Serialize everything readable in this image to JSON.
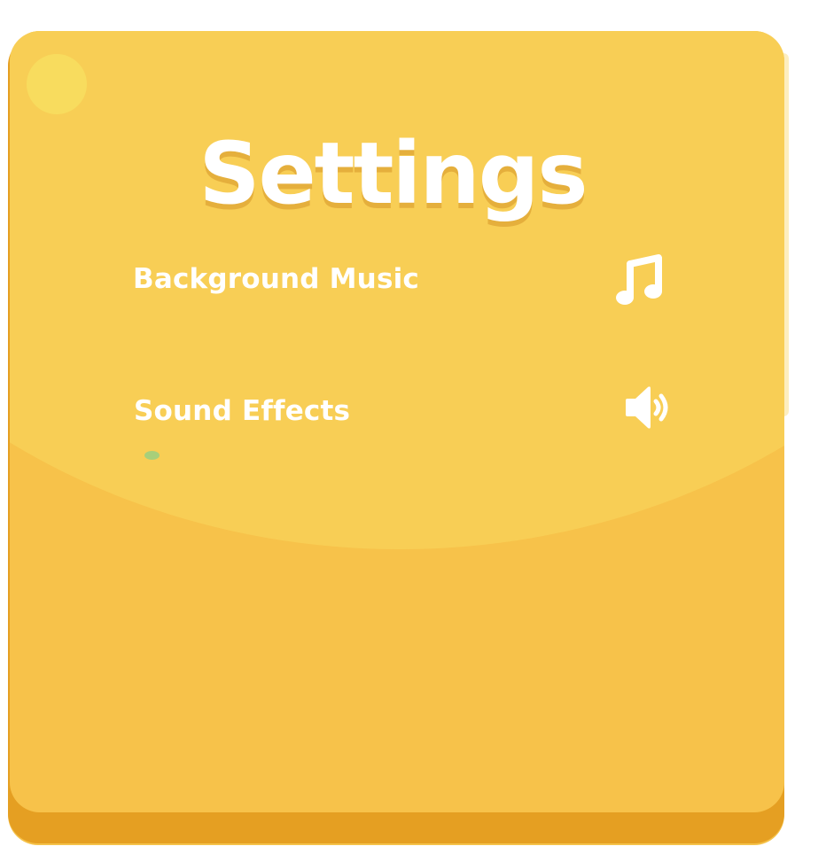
{
  "settings": {
    "title": "Settings",
    "options": [
      {
        "label": "Background Music",
        "icon": "music-note-icon"
      },
      {
        "label": "Sound Effects",
        "icon": "speaker-icon"
      }
    ]
  },
  "colors": {
    "panel": "#f7c24a",
    "panel_light": "#f8ce55",
    "panel_base": "#e59f22",
    "text": "#ffffff",
    "corner_dot": "#f8dc5e",
    "green_dot": "#a8cf7a"
  }
}
